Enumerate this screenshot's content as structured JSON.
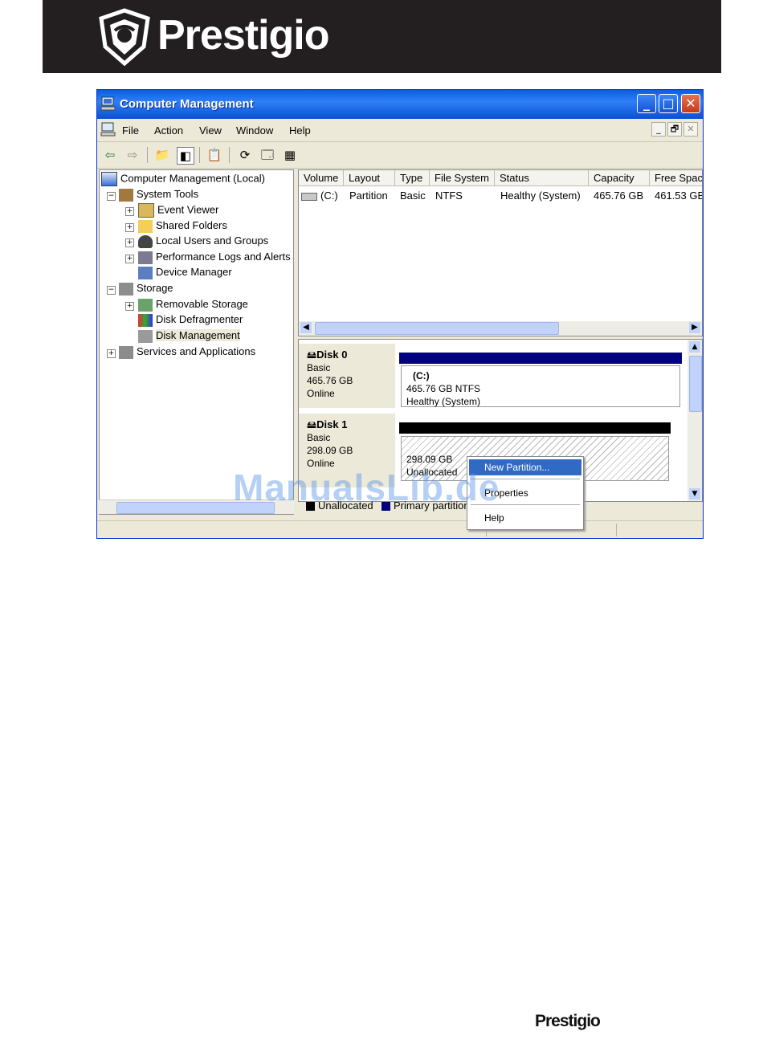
{
  "brand": {
    "name": "Prestigio",
    "footer_name": "Prestigio"
  },
  "window": {
    "title": "Computer Management",
    "controls": {
      "minimize": "_",
      "maximize": "□",
      "close": "✕"
    }
  },
  "menu": {
    "items": [
      "File",
      "Action",
      "View",
      "Window",
      "Help"
    ],
    "mdi_controls": [
      "_",
      "🗗",
      "✕"
    ]
  },
  "tree": {
    "root": "Computer Management (Local)",
    "system_tools": "System Tools",
    "event_viewer": "Event Viewer",
    "shared_folders": "Shared Folders",
    "local_users": "Local Users and Groups",
    "perf_logs": "Performance Logs and Alerts",
    "device_manager": "Device Manager",
    "storage": "Storage",
    "removable_storage": "Removable Storage",
    "disk_defrag": "Disk Defragmenter",
    "disk_management": "Disk Management",
    "services_apps": "Services and Applications"
  },
  "volume_table": {
    "columns": [
      "Volume",
      "Layout",
      "Type",
      "File System",
      "Status",
      "Capacity",
      "Free Spac"
    ],
    "rows": [
      {
        "volume": "(C:)",
        "layout": "Partition",
        "type": "Basic",
        "fs": "NTFS",
        "status": "Healthy (System)",
        "capacity": "465.76 GB",
        "free": "461.53 GB"
      }
    ]
  },
  "disks": {
    "disk0": {
      "name": "Disk 0",
      "type": "Basic",
      "size": "465.76 GB",
      "state": "Online",
      "volume_name": "(C:)",
      "volume_info": "465.76 GB NTFS",
      "volume_status": "Healthy (System)"
    },
    "disk1": {
      "name": "Disk 1",
      "type": "Basic",
      "size": "298.09 GB",
      "state": "Online",
      "volume_info": "298.09 GB",
      "volume_status": "Unallocated"
    }
  },
  "legend": {
    "unallocated": "Unallocated",
    "primary": "Primary partition"
  },
  "context_menu": {
    "new_partition": "New Partition...",
    "properties": "Properties",
    "help": "Help"
  },
  "watermark": "ManualsLib.de"
}
